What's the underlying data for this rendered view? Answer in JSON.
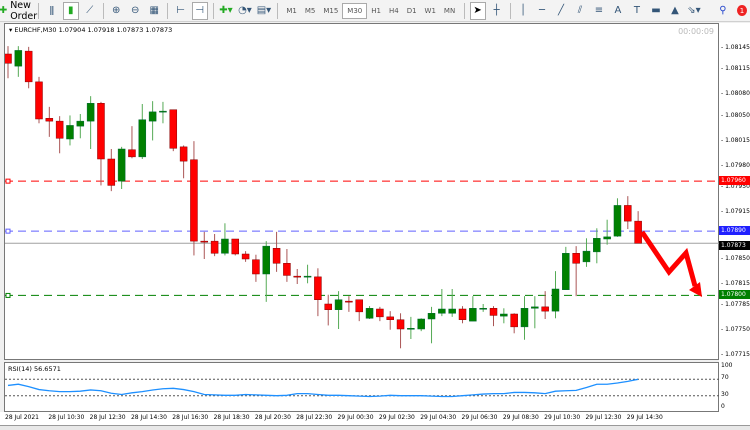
{
  "toolbar": {
    "new_order": "New Order",
    "timeframes": [
      "M1",
      "M5",
      "M15",
      "M30",
      "H1",
      "H4",
      "D1",
      "W1",
      "MN"
    ],
    "active_timeframe": "M30",
    "notification_count": "1"
  },
  "chart": {
    "symbol_line": "EURCHF,M30  1.07904 1.07918 1.07873 1.07873",
    "timer": "00:00:09"
  },
  "colors": {
    "bull": "#008000",
    "bear": "#ff0000",
    "level_red": "#ff0000",
    "level_blue": "#6060ff",
    "level_green": "#008000",
    "bid_line": "#a0a0a0",
    "rsi": "#1e90ff",
    "arrow": "#ff0000"
  },
  "price_axis": {
    "ticks": [
      "1.08145",
      "1.08115",
      "1.08080",
      "1.08050",
      "1.08015",
      "1.07980",
      "1.07950",
      "1.07915",
      "1.07850",
      "1.07815",
      "1.07785",
      "1.07750",
      "1.07715"
    ]
  },
  "levels": [
    {
      "price": "1.07960",
      "color": "red"
    },
    {
      "price": "1.07890",
      "color": "blue"
    },
    {
      "price": "1.07800",
      "color": "green"
    }
  ],
  "bid": {
    "price": "1.07873"
  },
  "rsi": {
    "label": "RSI(14) 56.6571",
    "ticks": [
      "100",
      "70",
      "30",
      "0"
    ]
  },
  "time_axis": [
    "28 Jul 2021",
    "28 Jul 10:30",
    "28 Jul 12:30",
    "28 Jul 14:30",
    "28 Jul 16:30",
    "28 Jul 18:30",
    "28 Jul 20:30",
    "28 Jul 22:30",
    "29 Jul 00:30",
    "29 Jul 02:30",
    "29 Jul 04:30",
    "29 Jul 06:30",
    "29 Jul 08:30",
    "29 Jul 10:30",
    "29 Jul 12:30",
    "29 Jul 14:30"
  ],
  "chart_data": {
    "type": "candlestick",
    "symbol": "EURCHF",
    "timeframe": "M30",
    "ylim": [
      1.077,
      1.0816
    ],
    "ohlc": [
      [
        1.08138,
        1.08149,
        1.08104,
        1.08125
      ],
      [
        1.08121,
        1.08149,
        1.08106,
        1.08143
      ],
      [
        1.08142,
        1.08148,
        1.0809,
        1.08099
      ],
      [
        1.08099,
        1.08106,
        1.08041,
        1.08047
      ],
      [
        1.08048,
        1.08064,
        1.08022,
        1.08044
      ],
      [
        1.08044,
        1.08051,
        1.07999,
        1.0802
      ],
      [
        1.08019,
        1.08052,
        1.0801,
        1.08038
      ],
      [
        1.08037,
        1.08054,
        1.0802,
        1.08044
      ],
      [
        1.08044,
        1.08079,
        1.08005,
        1.08069
      ],
      [
        1.08069,
        1.08071,
        1.07954,
        1.07991
      ],
      [
        1.07991,
        1.08005,
        1.07946,
        1.07954
      ],
      [
        1.0796,
        1.08008,
        1.07949,
        1.08005
      ],
      [
        1.08004,
        1.08037,
        1.07992,
        1.07994
      ],
      [
        1.07994,
        1.08068,
        1.07991,
        1.08046
      ],
      [
        1.08044,
        1.08072,
        1.08017,
        1.08057
      ],
      [
        1.08057,
        1.08071,
        1.08041,
        1.08058
      ],
      [
        1.0806,
        1.0806,
        1.08002,
        1.08006
      ],
      [
        1.08008,
        1.0801,
        1.07964,
        1.07988
      ],
      [
        1.0799,
        1.08016,
        1.07856,
        1.07876
      ],
      [
        1.07876,
        1.07889,
        1.07851,
        1.07875
      ],
      [
        1.07876,
        1.07886,
        1.07855,
        1.07859
      ],
      [
        1.07859,
        1.07901,
        1.07856,
        1.07879
      ],
      [
        1.07879,
        1.07879,
        1.07856,
        1.07858
      ],
      [
        1.07858,
        1.07862,
        1.07847,
        1.07851
      ],
      [
        1.0785,
        1.07857,
        1.07819,
        1.0783
      ],
      [
        1.0783,
        1.07876,
        1.07791,
        1.07869
      ],
      [
        1.07866,
        1.07889,
        1.07833,
        1.07845
      ],
      [
        1.07845,
        1.07865,
        1.07819,
        1.07828
      ],
      [
        1.07827,
        1.07837,
        1.07816,
        1.07826
      ],
      [
        1.07826,
        1.07843,
        1.07817,
        1.07827
      ],
      [
        1.07826,
        1.07838,
        1.07771,
        1.07794
      ],
      [
        1.07788,
        1.07801,
        1.07758,
        1.0778
      ],
      [
        1.0778,
        1.07806,
        1.07753,
        1.07794
      ],
      [
        1.07792,
        1.07799,
        1.07777,
        1.07791
      ],
      [
        1.07794,
        1.07794,
        1.07764,
        1.07777
      ],
      [
        1.07768,
        1.07785,
        1.07767,
        1.07782
      ],
      [
        1.07781,
        1.07784,
        1.07764,
        1.0777
      ],
      [
        1.0777,
        1.07778,
        1.07752,
        1.07766
      ],
      [
        1.07766,
        1.07775,
        1.07726,
        1.07753
      ],
      [
        1.07753,
        1.0777,
        1.07739,
        1.07754
      ],
      [
        1.07753,
        1.07768,
        1.0775,
        1.07767
      ],
      [
        1.07767,
        1.07784,
        1.07733,
        1.07775
      ],
      [
        1.07775,
        1.07809,
        1.07771,
        1.07781
      ],
      [
        1.07775,
        1.07809,
        1.0777,
        1.07781
      ],
      [
        1.07781,
        1.07785,
        1.07761,
        1.07766
      ],
      [
        1.07764,
        1.07799,
        1.07764,
        1.07782
      ],
      [
        1.07781,
        1.07788,
        1.07777,
        1.07782
      ],
      [
        1.07782,
        1.07785,
        1.07757,
        1.07772
      ],
      [
        1.07771,
        1.07782,
        1.07761,
        1.07774
      ],
      [
        1.07774,
        1.07775,
        1.07747,
        1.07756
      ],
      [
        1.07756,
        1.07799,
        1.07738,
        1.07782
      ],
      [
        1.07782,
        1.07799,
        1.07754,
        1.07784
      ],
      [
        1.07784,
        1.07806,
        1.07767,
        1.07778
      ],
      [
        1.07778,
        1.07834,
        1.07768,
        1.07809
      ],
      [
        1.07808,
        1.07868,
        1.07808,
        1.07859
      ],
      [
        1.07859,
        1.07869,
        1.07799,
        1.07845
      ],
      [
        1.07847,
        1.0788,
        1.0784,
        1.07862
      ],
      [
        1.07861,
        1.07894,
        1.07845,
        1.0788
      ],
      [
        1.07879,
        1.07906,
        1.07871,
        1.07882
      ],
      [
        1.07883,
        1.07936,
        1.07882,
        1.07926
      ],
      [
        1.07926,
        1.07939,
        1.07893,
        1.07904
      ],
      [
        1.07904,
        1.07918,
        1.07873,
        1.07873
      ]
    ],
    "rsi_values": [
      55,
      58,
      52,
      45,
      42,
      40,
      40,
      41,
      44,
      42,
      36,
      33,
      37,
      40,
      44,
      47,
      48,
      45,
      40,
      33,
      32,
      31,
      31,
      33,
      32,
      31,
      30,
      31,
      35,
      35,
      33,
      31,
      31,
      30,
      29,
      28,
      29,
      31,
      30,
      30,
      30,
      29,
      28,
      28,
      30,
      32,
      34,
      35,
      35,
      38,
      38,
      37,
      35,
      41,
      42,
      43,
      50,
      58,
      58,
      61,
      65,
      70,
      64,
      57
    ],
    "rsi_levels": [
      70,
      30
    ]
  }
}
